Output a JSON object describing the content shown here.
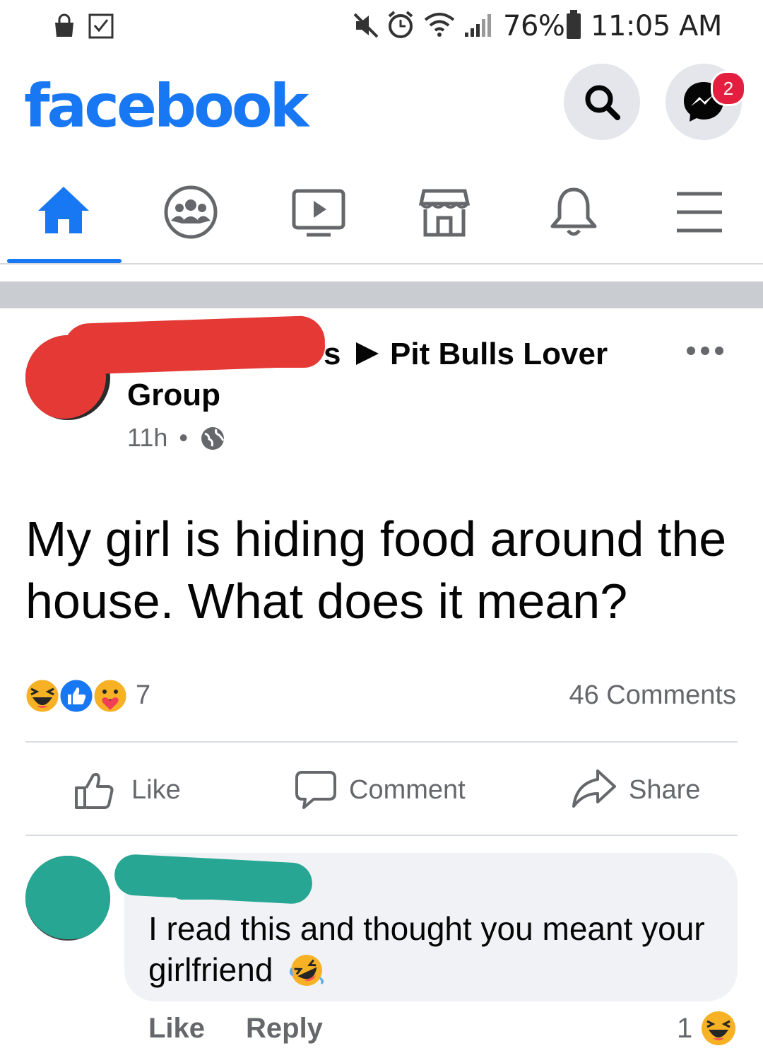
{
  "status_bar": {
    "battery": "76%",
    "time": "11:05 AM"
  },
  "header": {
    "logo_text": "facebook",
    "messenger_badge_count": "2",
    "brand_color": "#1877f2"
  },
  "nav": {
    "active_tab": "home",
    "tabs": [
      "home-icon",
      "groups-icon",
      "watch-icon",
      "marketplace-icon",
      "notifications-icon",
      "menu-icon"
    ]
  },
  "post": {
    "author_visible_fragment": "s",
    "group_name_line1": "Pit Bulls Lover",
    "group_name_line2": "Group",
    "time": "11h",
    "separator": "•",
    "text": "My girl is hiding food around the house. What does it mean?",
    "reactions_count": "7",
    "comments_count": "46 Comments",
    "actions": {
      "like": "Like",
      "comment": "Comment",
      "share": "Share"
    }
  },
  "comment": {
    "text": "I read this and thought you meant your girlfriend",
    "like_label": "Like",
    "reply_label": "Reply",
    "reaction_count": "1"
  }
}
